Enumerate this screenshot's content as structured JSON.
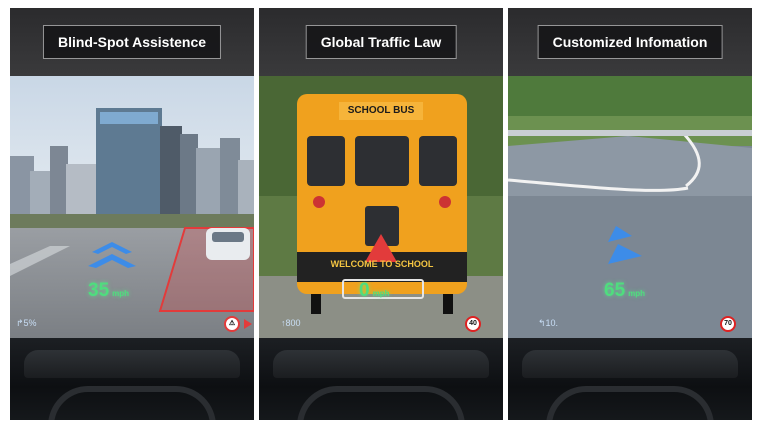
{
  "panels": [
    {
      "title": "Blind-Spot Assistence",
      "speed_value": "35",
      "speed_unit": "mph",
      "bottom_left_info": "↱5%",
      "sign_label": ""
    },
    {
      "title": "Global Traffic Law",
      "speed_value": "0",
      "speed_unit": "mph",
      "bottom_left_info": "↑800",
      "sign_label": "40",
      "bus_top_text": "SCHOOL BUS",
      "bus_banner_text": "WELCOME TO SCHOOL"
    },
    {
      "title": "Customized Infomation",
      "speed_value": "65",
      "speed_unit": "mph",
      "bottom_left_info": "↰10.",
      "sign_label": "70"
    }
  ],
  "colors": {
    "hud_green": "#4fdd7e",
    "hud_blue": "#3d8ce8",
    "warning_red": "#e23b3b"
  }
}
